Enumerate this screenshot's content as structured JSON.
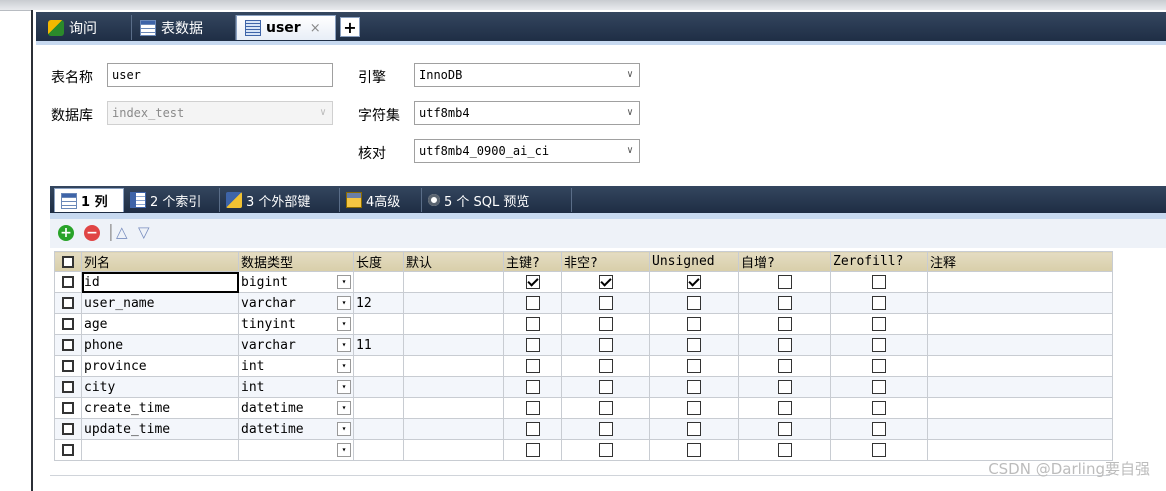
{
  "tabs": [
    {
      "label": "询问",
      "icon": "query-icon",
      "active": false
    },
    {
      "label": "表数据",
      "icon": "table-icon",
      "active": false
    },
    {
      "label": "user",
      "icon": "design-icon",
      "active": true,
      "close": "×"
    }
  ],
  "add_tab": "+",
  "form": {
    "table_name_label": "表名称",
    "table_name_value": "user",
    "database_label": "数据库",
    "database_value": "index_test",
    "engine_label": "引擎",
    "engine_value": "InnoDB",
    "charset_label": "字符集",
    "charset_value": "utf8mb4",
    "collation_label": "核对",
    "collation_value": "utf8mb4_0900_ai_ci",
    "caret": "∨"
  },
  "sub_tabs": [
    {
      "label": "1 列",
      "icon": "columns-icon"
    },
    {
      "label": "2 个索引",
      "icon": "index-icon"
    },
    {
      "label": "3 个外部键",
      "icon": "foreign-key-icon"
    },
    {
      "label": "4高级",
      "icon": "advanced-icon"
    },
    {
      "label": "5 个 SQL 预览",
      "icon": "sql-preview-icon"
    }
  ],
  "toolbar": {
    "add": "+",
    "remove": "−",
    "up": "△",
    "down": "▽"
  },
  "grid": {
    "headers": [
      "列名",
      "数据类型",
      "长度",
      "默认",
      "主键?",
      "非空?",
      "Unsigned",
      "自增?",
      "Zerofill?",
      "注释"
    ],
    "dropdown_glyph": "▾",
    "rows": [
      {
        "name": "id",
        "type": "bigint",
        "length": "",
        "default": "",
        "pk": true,
        "notnull": true,
        "unsigned": true,
        "autoinc": false,
        "zerofill": false,
        "comment": "",
        "selected": true
      },
      {
        "name": "user_name",
        "type": "varchar",
        "length": "12",
        "default": "",
        "pk": false,
        "notnull": false,
        "unsigned": false,
        "autoinc": false,
        "zerofill": false,
        "comment": ""
      },
      {
        "name": "age",
        "type": "tinyint",
        "length": "",
        "default": "",
        "pk": false,
        "notnull": false,
        "unsigned": false,
        "autoinc": false,
        "zerofill": false,
        "comment": ""
      },
      {
        "name": "phone",
        "type": "varchar",
        "length": "11",
        "default": "",
        "pk": false,
        "notnull": false,
        "unsigned": false,
        "autoinc": false,
        "zerofill": false,
        "comment": ""
      },
      {
        "name": "province",
        "type": "int",
        "length": "",
        "default": "",
        "pk": false,
        "notnull": false,
        "unsigned": false,
        "autoinc": false,
        "zerofill": false,
        "comment": ""
      },
      {
        "name": "city",
        "type": "int",
        "length": "",
        "default": "",
        "pk": false,
        "notnull": false,
        "unsigned": false,
        "autoinc": false,
        "zerofill": false,
        "comment": ""
      },
      {
        "name": "create_time",
        "type": "datetime",
        "length": "",
        "default": "",
        "pk": false,
        "notnull": false,
        "unsigned": false,
        "autoinc": false,
        "zerofill": false,
        "comment": ""
      },
      {
        "name": "update_time",
        "type": "datetime",
        "length": "",
        "default": "",
        "pk": false,
        "notnull": false,
        "unsigned": false,
        "autoinc": false,
        "zerofill": false,
        "comment": ""
      },
      {
        "name": "",
        "type": "",
        "length": "",
        "default": "",
        "pk": false,
        "notnull": false,
        "unsigned": false,
        "autoinc": false,
        "zerofill": false,
        "comment": ""
      }
    ]
  },
  "watermark": "CSDN @Darling要自强"
}
